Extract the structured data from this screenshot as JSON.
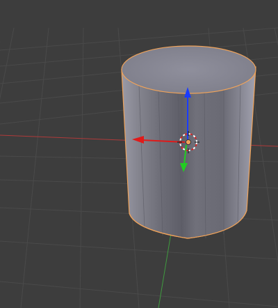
{
  "viewport": {
    "background_color": "#3d3d3d",
    "grid_color": "#4a4a4a",
    "x_axis_color": "#b03a3a",
    "y_axis_color": "#3f9b3f",
    "selection_outline_color": "#f0a35a",
    "transform_x_color": "#e01a1a",
    "transform_y_color": "#22cc22",
    "transform_z_color": "#1a3cff",
    "selected_object": "cylinder",
    "manipulator": "translate-gizmo",
    "cursor": "3d-cursor"
  }
}
